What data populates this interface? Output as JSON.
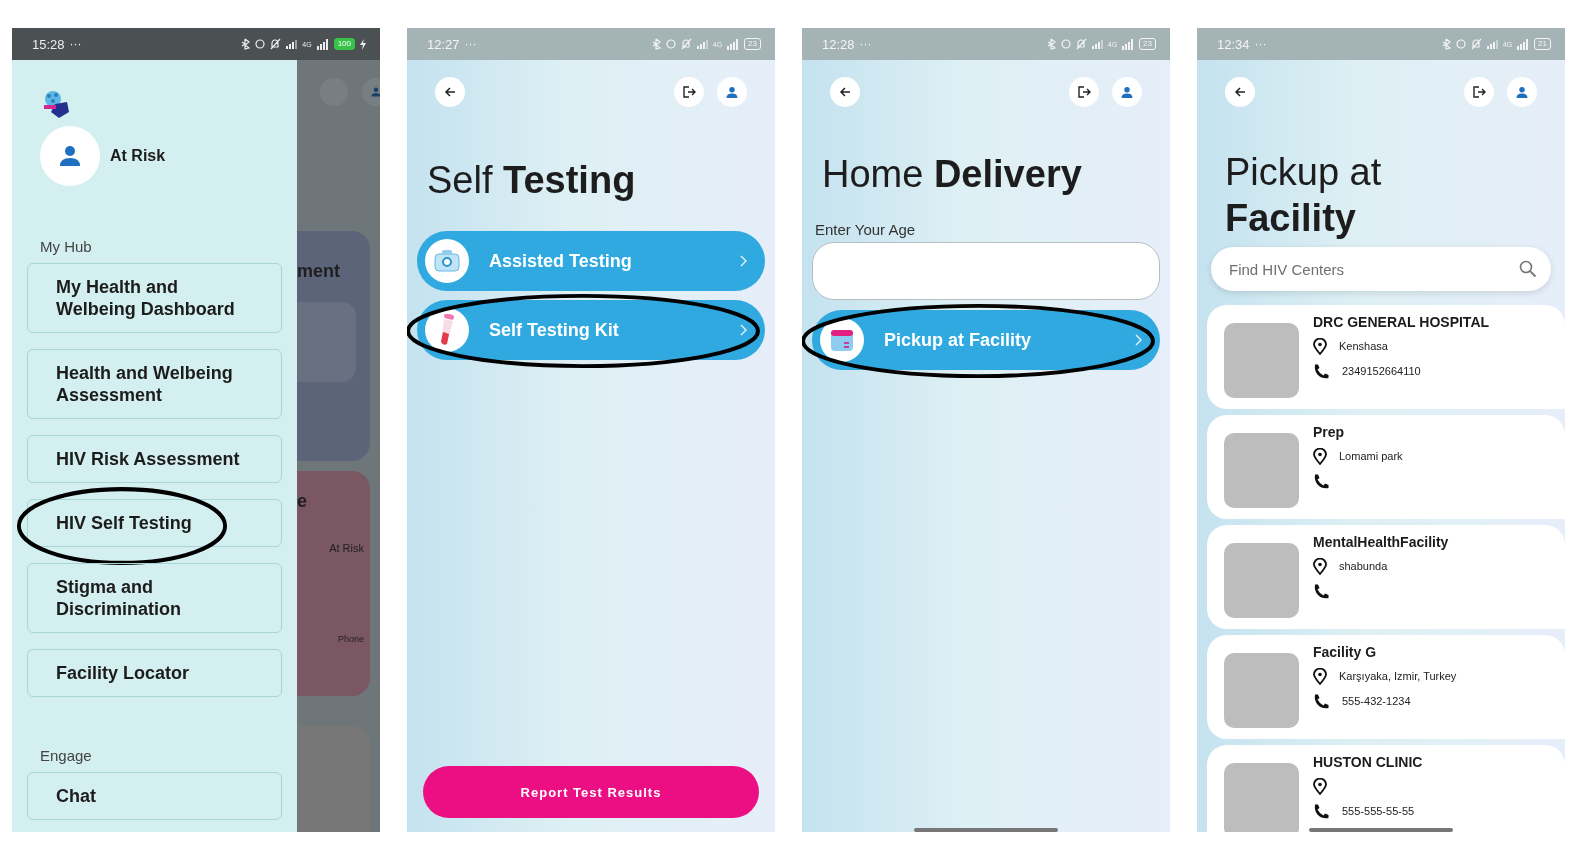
{
  "screens": [
    {
      "kind": "drawer",
      "status": {
        "time": "15:28",
        "extra": "···",
        "network": "4G",
        "battery": "100",
        "charging": true
      },
      "drawer": {
        "user": "At Risk",
        "sections": [
          {
            "title": "My Hub",
            "items": [
              {
                "label": "My Health and Welbeing Dashboard",
                "circled": false
              },
              {
                "label": "Health and Welbeing Assessment",
                "circled": false
              },
              {
                "label": "HIV Risk Assessment",
                "circled": false
              },
              {
                "label": "HIV Self Testing",
                "circled": true
              },
              {
                "label": "Stigma and Discrimination",
                "circled": false
              },
              {
                "label": "Facility  Locator",
                "circled": false
              }
            ]
          },
          {
            "title": "Engage",
            "items": [
              {
                "label": "Chat",
                "circled": false
              }
            ]
          }
        ]
      },
      "behind": {
        "card_title": "ment",
        "card2_title": "e",
        "card2_label": "At Risk",
        "card2_note": "Phone"
      }
    },
    {
      "kind": "options",
      "status": {
        "time": "12:27",
        "extra": "···",
        "network": "4G",
        "battery": "23",
        "charging": false
      },
      "title": "Self **Testing**",
      "options": [
        {
          "label": "Assisted Testing",
          "kind": "kit",
          "circled": false
        },
        {
          "label": "Self Testing Kit",
          "kind": "tube",
          "circled": true
        }
      ],
      "bottom_button": "Report Test Results"
    },
    {
      "kind": "age",
      "status": {
        "time": "12:28",
        "extra": "···",
        "network": "4G",
        "battery": "23",
        "charging": false
      },
      "title": "Home **Delivery**",
      "field_label": "Enter Your Age",
      "options": [
        {
          "label": "Pickup at Facility",
          "kind": "box",
          "circled": true
        }
      ]
    },
    {
      "kind": "facilities",
      "status": {
        "time": "12:34",
        "extra": "···",
        "network": "4G",
        "battery": "21",
        "charging": false
      },
      "title": "Pickup at **Facility**",
      "search": {
        "placeholder": "Find HIV Centers"
      },
      "facilities": [
        {
          "name": "DRC GENERAL HOSPITAL",
          "location": "Kenshasa",
          "phone": "2349152664110"
        },
        {
          "name": "Prep",
          "location": "Lomami park"
        },
        {
          "name": "MentalHealthFacility",
          "location": "shabunda"
        },
        {
          "name": "Facility G",
          "location": "Karşıyaka, Izmir, Turkey",
          "phone": "555-432-1234"
        },
        {
          "name": "HUSTON CLINIC",
          "phone": "555-555-55-55"
        }
      ]
    }
  ]
}
